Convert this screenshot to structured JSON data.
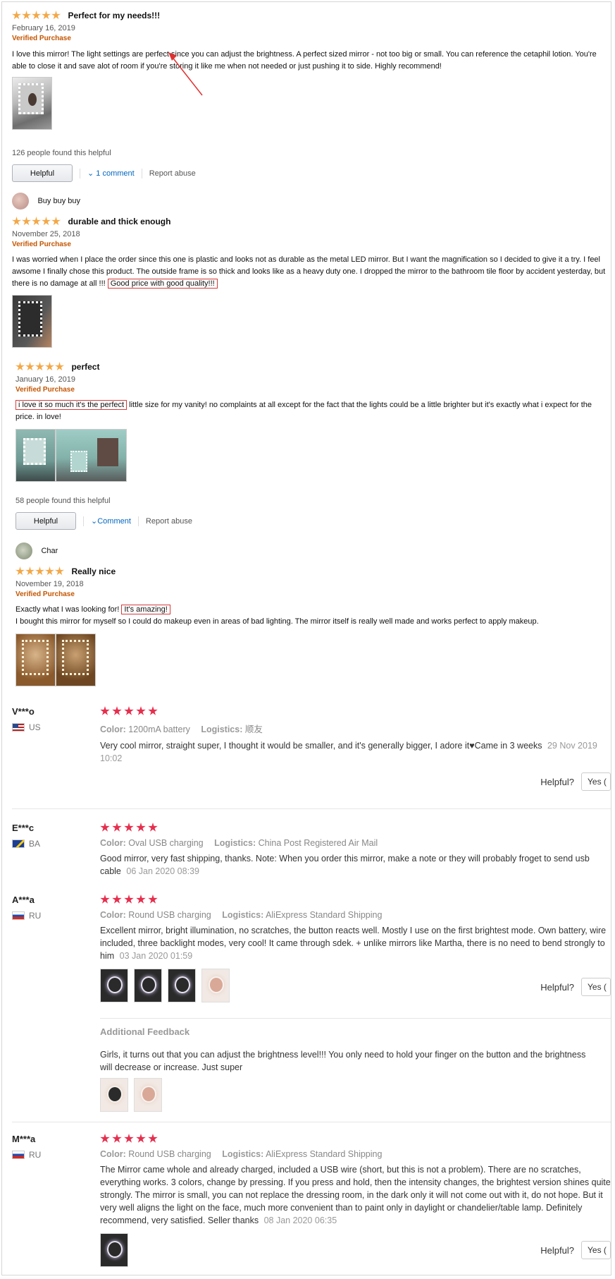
{
  "amazon": {
    "reviews": [
      {
        "title": "Perfect for my needs!!!",
        "date": "February 16, 2019",
        "verified": "Verified Purchase",
        "body": "I love this mirror! The light settings are perfect since you can adjust the brightness. A perfect sized mirror - not too big or small. You can reference the cetaphil lotion. You're able to close it and save alot of room if you're storing it like me when not needed or just pushing it to side. Highly recommend!",
        "helpful_count": "126 people found this helpful",
        "helpful_label": "Helpful",
        "comment_label": "1 comment",
        "report_label": "Report abuse"
      },
      {
        "author": "Buy buy buy",
        "title": "durable and thick enough",
        "date": "November 25, 2018",
        "verified": "Verified Purchase",
        "body_pre": "I was worried when I place the order since this one is plastic and looks not as durable as the metal LED mirror. But I want the magnification so I decided to give it a try. I feel awsome I finally chose this product. The outside frame is so thick and looks like as a heavy duty one. I dropped the mirror to the bathroom tile floor by accident yesterday, but there is no damage at all !!! ",
        "body_highlight": "Good price with good quality!!!"
      },
      {
        "title": "perfect",
        "date": "January 16, 2019",
        "verified": "Verified Purchase",
        "body_highlight": "i love it so much it's the perfect",
        "body_post": " little size for my vanity! no complaints at all except for the fact that the lights could be a little brighter but it's exactly what i expect for the price. in love!",
        "helpful_count": "58 people found this helpful",
        "helpful_label": "Helpful",
        "comment_label": "Comment",
        "report_label": "Report abuse"
      },
      {
        "author": "Char",
        "title": "Really nice",
        "date": "November 19, 2018",
        "verified": "Verified Purchase",
        "body_pre": "Exactly what I was looking for! ",
        "body_highlight": "It's amazing!",
        "body_line2": "I bought this mirror for myself so I could do makeup even in areas of bad lighting. The mirror itself is really well made and works perfect to apply makeup."
      }
    ]
  },
  "aliexpress": {
    "color_label": "Color:",
    "logistics_label": "Logistics:",
    "helpful_label": "Helpful?",
    "yes_label": "Yes (",
    "additional_feedback_label": "Additional Feedback",
    "reviews": [
      {
        "name": "V***o",
        "country": "US",
        "color": "1200mA battery",
        "logistics": "顺友",
        "text": "Very cool mirror, straight super, I thought it would be smaller, and it's generally bigger, I adore it♥Came in 3 weeks",
        "date": "29 Nov 2019 10:02"
      },
      {
        "name": "E***c",
        "country": "BA",
        "color": "Oval USB charging",
        "logistics": "China Post Registered Air Mail",
        "text": "Good mirror, very fast shipping, thanks. Note: When you order this mirror, make a note or they will probably froget to send usb cable",
        "date": "06 Jan 2020 08:39"
      },
      {
        "name": "A***a",
        "country": "RU",
        "color": "Round USB charging",
        "logistics": "AliExpress Standard Shipping",
        "text": "Excellent mirror, bright illumination, no scratches, the button reacts well. Mostly I use on the first brightest mode. Own battery, wire included, three backlight modes, very cool! It came through sdek. + unlike mirrors like Martha, there is no need to bend strongly to him",
        "date": "03 Jan 2020 01:59",
        "additional": "Girls, it turns out that you can adjust the brightness level!!! You only need to hold your finger on the button and the brightness will decrease or increase. Just super"
      },
      {
        "name": "M***a",
        "country": "RU",
        "color": "Round USB charging",
        "logistics": "AliExpress Standard Shipping",
        "text": "The Mirror came whole and already charged, included a USB wire (short, but this is not a problem). There are no scratches, everything works. 3 colors, change by pressing. If you press and hold, then the intensity changes, the brightest version shines quite strongly. The mirror is small, you can not replace the dressing room, in the dark only it will not come out with it, do not hope. But it very well aligns the light on the face, much more convenient than to paint only in daylight or chandelier/table lamp. Definitely recommend, very satisfied. Seller thanks",
        "date": "08 Jan 2020 06:35"
      }
    ]
  },
  "colors": {
    "amazon_star": "#f3a847",
    "verified": "#c45500",
    "link": "#0066c0",
    "highlight_box": "#d93a3a",
    "ali_star": "#e62e4d"
  }
}
